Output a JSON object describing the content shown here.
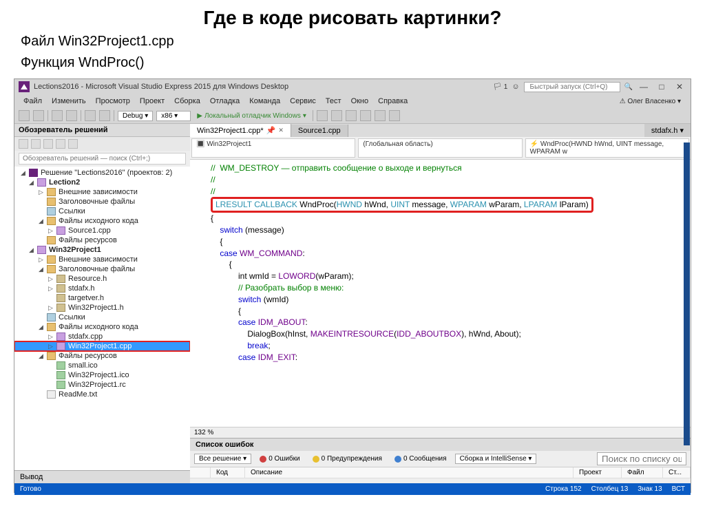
{
  "slide": {
    "title": "Где в коде рисовать картинки?",
    "sub1": "Файл Win32Project1.cpp",
    "sub2": "Функция WndProc()"
  },
  "titlebar": {
    "title": "Lections2016 - Microsoft Visual Studio Express 2015 для Windows Desktop",
    "flag_count": "1",
    "quick_launch_ph": "Быстрый запуск (Ctrl+Q)"
  },
  "menu": [
    "Файл",
    "Изменить",
    "Просмотр",
    "Проект",
    "Сборка",
    "Отладка",
    "Команда",
    "Сервис",
    "Тест",
    "Окно",
    "Справка"
  ],
  "user": "Олег Власенко",
  "toolbar": {
    "config": "Debug",
    "platform": "x86",
    "debug": "Локальный отладчик Windows"
  },
  "solution": {
    "header": "Обозреватель решений",
    "search_ph": "Обозреватель решений — поиск (Ctrl+;)",
    "root": "Решение \"Lections2016\" (проектов: 2)",
    "lection2": "Lection2",
    "l2_deps": "Внешние зависимости",
    "l2_hdr": "Заголовочные файлы",
    "l2_ref": "Ссылки",
    "l2_src": "Файлы исходного кода",
    "l2_src1": "Source1.cpp",
    "l2_res": "Файлы ресурсов",
    "win32": "Win32Project1",
    "w_deps": "Внешние зависимости",
    "w_hdr": "Заголовочные файлы",
    "w_h1": "Resource.h",
    "w_h2": "stdafx.h",
    "w_h3": "targetver.h",
    "w_h4": "Win32Project1.h",
    "w_ref": "Ссылки",
    "w_src": "Файлы исходного кода",
    "w_src1": "stdafx.cpp",
    "w_src2": "Win32Project1.cpp",
    "w_res": "Файлы ресурсов",
    "w_res1": "small.ico",
    "w_res2": "Win32Project1.ico",
    "w_res3": "Win32Project1.rc",
    "readme": "ReadMe.txt",
    "output_tab": "Вывод"
  },
  "editor": {
    "tab1": "Win32Project1.cpp*",
    "tab2": "Source1.cpp",
    "tab_right": "stdafx.h",
    "combo1": "Win32Project1",
    "combo2": "(Глобальная область)",
    "combo3": "WndProc(HWND hWnd, UINT message, WPARAM w",
    "zoom": "132 %"
  },
  "code": {
    "l1": "//  WM_DESTROY — отправить сообщение о выходе и вернуться",
    "l2": "//",
    "l3": "//",
    "sig_pre": "LRESULT CALLBACK ",
    "sig_fn": "WndProc(",
    "sig_p1t": "HWND",
    "sig_p1n": " hWnd, ",
    "sig_p2t": "UINT",
    "sig_p2n": " message, ",
    "sig_p3t": "WPARAM",
    "sig_p3n": " wParam, ",
    "sig_p4t": "LPARAM",
    "sig_p4n": " lParam)",
    "l5": "{",
    "l6": "    switch (message)",
    "l7": "    {",
    "l8": "    case ",
    "l8m": "WM_COMMAND",
    "l8e": ":",
    "l9": "        {",
    "l10a": "            int wmId = ",
    "l10m": "LOWORD",
    "l10b": "(wParam);",
    "l11": "            // Разобрать выбор в меню:",
    "l12": "            switch (wmId)",
    "l13": "            {",
    "l14a": "            case ",
    "l14m": "IDM_ABOUT",
    "l14e": ":",
    "l15a": "                DialogBox(hInst, ",
    "l15m": "MAKEINTRESOURCE",
    "l15b": "(",
    "l15c": "IDD_ABOUTBOX",
    "l15d": "), hWnd, About);",
    "l16": "                break;",
    "l17a": "            case ",
    "l17m": "IDM_EXIT",
    "l17e": ":"
  },
  "errors": {
    "header": "Список ошибок",
    "scope": "Все решение",
    "err": "0 Ошибки",
    "warn": "0 Предупреждения",
    "msg": "0 Сообщения",
    "build": "Сборка и IntelliSense",
    "search_ph": "Поиск по списку ошибок",
    "col_code": "Код",
    "col_desc": "Описание",
    "col_proj": "Проект",
    "col_file": "Файл",
    "col_line": "Ст..."
  },
  "status": {
    "ready": "Готово",
    "line": "Строка 152",
    "col": "Столбец 13",
    "char": "Знак 13",
    "ins": "ВСТ"
  }
}
